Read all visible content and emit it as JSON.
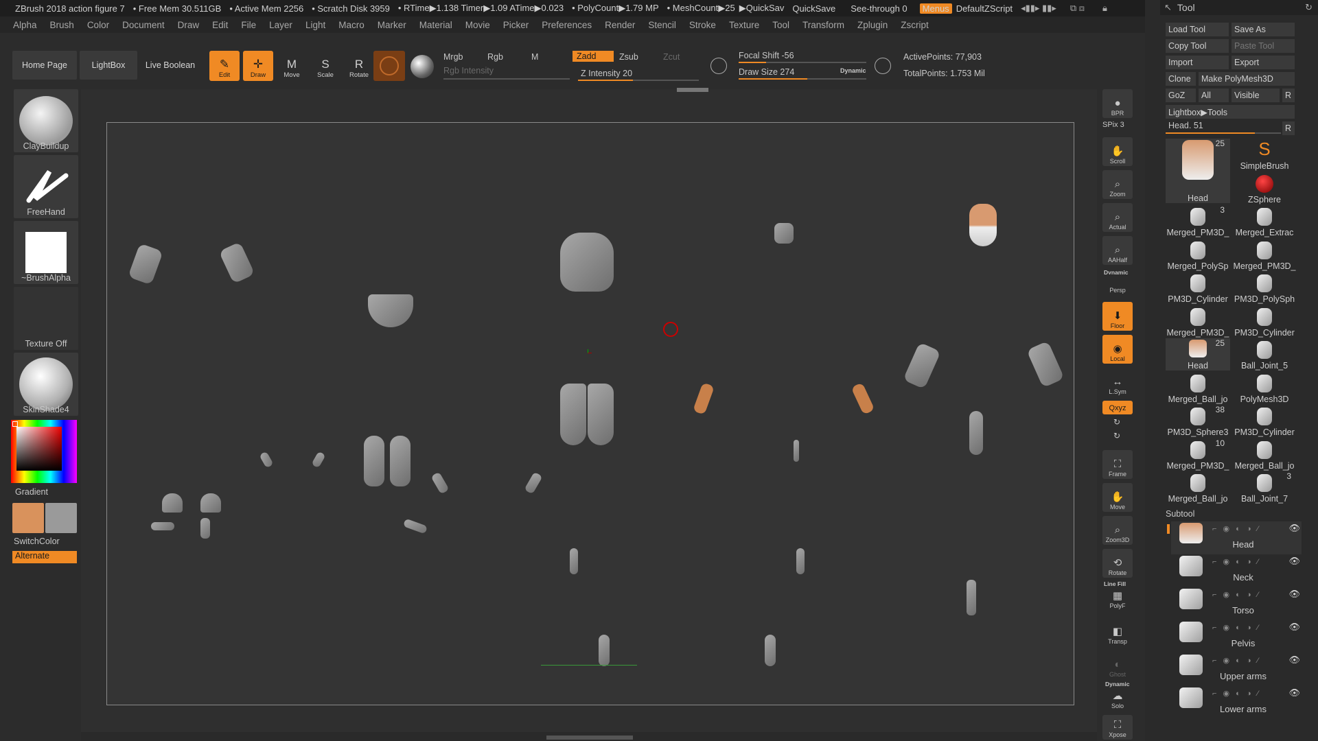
{
  "titlebar": {
    "app_title": "ZBrush 2018 action figure 7",
    "free_mem": "• Free Mem 30.511GB",
    "active_mem": "• Active Mem 2256",
    "scratch": "• Scratch Disk 3959",
    "rtime": "• RTime▶1.138 Timer▶1.09 ATime▶0.023",
    "polycount": "• PolyCount▶1.79 MP",
    "meshcount": "• MeshCount▶25",
    "quicksav": "▶QuickSav",
    "quicksave": "QuickSave",
    "see_through": "See-through  0",
    "menus": "Menus",
    "default_script": "DefaultZScript"
  },
  "menubar": [
    "Alpha",
    "Brush",
    "Color",
    "Document",
    "Draw",
    "Edit",
    "File",
    "Layer",
    "Light",
    "Macro",
    "Marker",
    "Material",
    "Movie",
    "Picker",
    "Preferences",
    "Render",
    "Stencil",
    "Stroke",
    "Texture",
    "Tool",
    "Transform",
    "Zplugin",
    "Zscript"
  ],
  "shelf": {
    "home_page": "Home Page",
    "lightbox": "LightBox",
    "live_boolean": "Live Boolean",
    "edit": "Edit",
    "draw": "Draw",
    "move": "Move",
    "scale": "Scale",
    "rotate": "Rotate",
    "mrgb": "Mrgb",
    "rgb": "Rgb",
    "m": "M",
    "rgb_intensity": "Rgb Intensity",
    "zadd": "Zadd",
    "zsub": "Zsub",
    "zcut": "Zcut",
    "z_intensity": "Z Intensity 20",
    "focal_shift": "Focal Shift -56",
    "draw_size": "Draw Size 274",
    "dynamic": "Dynamic",
    "active_points": "ActivePoints: 77,903",
    "total_points": "TotalPoints: 1.753 Mil"
  },
  "leftpanel": {
    "brush": "ClayBuildup",
    "stroke": "FreeHand",
    "alpha": "~BrushAlpha",
    "texture": "Texture Off",
    "material": "SkinShade4",
    "gradient": "Gradient",
    "switch_color": "SwitchColor",
    "alternate": "Alternate",
    "main_color": "#d9925c",
    "secondary_color": "#9a9a9a"
  },
  "rstrip": {
    "bpr": "BPR",
    "spix": "SPix 3",
    "scroll": "Scroll",
    "zoom": "Zoom",
    "actual": "Actual",
    "aahalf": "AAHalf",
    "dynamic": "Dynamic",
    "persp": "Persp",
    "floor": "Floor",
    "local": "Local",
    "lsym": "L.Sym",
    "xyz": "Qxyz",
    "frame": "Frame",
    "move": "Move",
    "zoom3d": "Zoom3D",
    "rotate": "Rotate",
    "line_fill": "Line Fill",
    "polyf": "PolyF",
    "transp": "Transp",
    "ghost": "Ghost",
    "dynamic2": "Dynamic",
    "solo": "Solo",
    "xpose": "Xpose"
  },
  "toolpanel": {
    "title": "Tool",
    "load_tool": "Load Tool",
    "save_as": "Save As",
    "copy_tool": "Copy Tool",
    "paste_tool": "Paste Tool",
    "import": "Import",
    "export": "Export",
    "clone": "Clone",
    "make_polymesh": "Make PolyMesh3D",
    "goz": "GoZ",
    "all": "All",
    "visible": "Visible",
    "r": "R",
    "lightbox_tools": "Lightbox▶Tools",
    "head_slider": "Head. 51",
    "tools": [
      {
        "label": "Head",
        "count": "25"
      },
      {
        "label": "SimpleBrush",
        "count": ""
      },
      {
        "label": "ZSphere",
        "count": ""
      },
      {
        "label": "Merged_PM3D_",
        "count": "3"
      },
      {
        "label": "Merged_Extrac",
        "count": ""
      },
      {
        "label": "Merged_PolySp",
        "count": ""
      },
      {
        "label": "Merged_PM3D_",
        "count": ""
      },
      {
        "label": "PM3D_Cylinder",
        "count": ""
      },
      {
        "label": "PM3D_PolySph",
        "count": ""
      },
      {
        "label": "Merged_PM3D_",
        "count": ""
      },
      {
        "label": "PM3D_Cylinder",
        "count": ""
      },
      {
        "label": "Head",
        "count": "25"
      },
      {
        "label": "Ball_Joint_5",
        "count": ""
      },
      {
        "label": "Merged_Ball_jo",
        "count": ""
      },
      {
        "label": "PolyMesh3D",
        "count": ""
      },
      {
        "label": "PM3D_Sphere3",
        "count": "38"
      },
      {
        "label": "PM3D_Cylinder",
        "count": ""
      },
      {
        "label": "Merged_PM3D_",
        "count": "10"
      },
      {
        "label": "Merged_Ball_jo",
        "count": ""
      },
      {
        "label": "Merged_Ball_jo",
        "count": ""
      },
      {
        "label": "Ball_Joint_7",
        "count": "3"
      }
    ],
    "subtool_title": "Subtool",
    "subtools": [
      "Head",
      "Neck",
      "Torso",
      "Pelvis",
      "Upper arms",
      "Lower arms"
    ]
  }
}
